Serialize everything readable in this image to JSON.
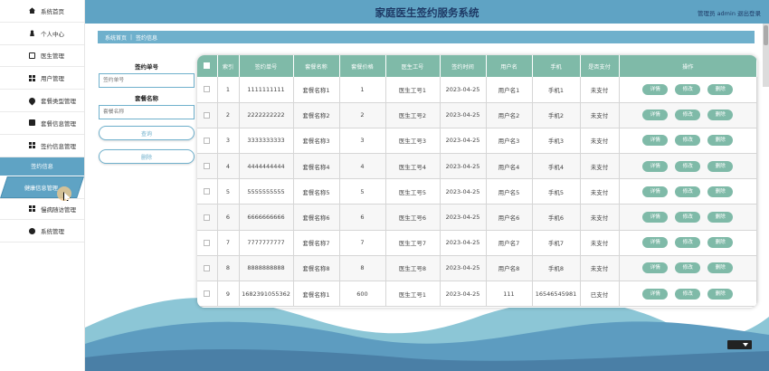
{
  "app": {
    "title": "家庭医生签约服务系统",
    "admin_text": "管理员 admin  退出登录"
  },
  "sidebar": {
    "items_top": [
      {
        "label": "系统首页",
        "icon": "home-icon"
      },
      {
        "label": "个人中心",
        "icon": "user-icon"
      },
      {
        "label": "医生管理",
        "icon": "document-icon"
      },
      {
        "label": "用户管理",
        "icon": "grid-icon"
      },
      {
        "label": "套餐类型管理",
        "icon": "pin-icon"
      },
      {
        "label": "套餐信息管理",
        "icon": "monitor-icon"
      },
      {
        "label": "签约信息管理",
        "icon": "grid-icon"
      }
    ],
    "section_label": "签约信息",
    "active_item": {
      "label": "健康信息管理",
      "icon": "user-icon"
    },
    "items_bottom": [
      {
        "label": "慢病随访管理",
        "icon": "grid-icon"
      },
      {
        "label": "系统管理",
        "icon": "gear-icon"
      }
    ]
  },
  "breadcrumb": {
    "home": "系统首页",
    "separator": "|",
    "current": "签约信息"
  },
  "search": {
    "sign_no_label": "签约单号",
    "sign_no_placeholder": "签约单号",
    "package_label": "套餐名称",
    "package_placeholder": "套餐名称",
    "query_button": "查询",
    "delete_button": "删除"
  },
  "table": {
    "columns": [
      "索引",
      "签约单号",
      "套餐名称",
      "套餐价格",
      "医生工号",
      "签约时间",
      "用户名",
      "手机",
      "是否支付",
      "操作"
    ],
    "action_labels": {
      "detail": "详情",
      "edit": "修改",
      "delete": "删除"
    },
    "rows": [
      [
        "1",
        "1111111111",
        "套餐名称1",
        "1",
        "医生工号1",
        "2023-04-25",
        "用户名1",
        "手机1",
        "未支付"
      ],
      [
        "2",
        "2222222222",
        "套餐名称2",
        "2",
        "医生工号2",
        "2023-04-25",
        "用户名2",
        "手机2",
        "未支付"
      ],
      [
        "3",
        "3333333333",
        "套餐名称3",
        "3",
        "医生工号3",
        "2023-04-25",
        "用户名3",
        "手机3",
        "未支付"
      ],
      [
        "4",
        "4444444444",
        "套餐名称4",
        "4",
        "医生工号4",
        "2023-04-25",
        "用户名4",
        "手机4",
        "未支付"
      ],
      [
        "5",
        "5555555555",
        "套餐名称5",
        "5",
        "医生工号5",
        "2023-04-25",
        "用户名5",
        "手机5",
        "未支付"
      ],
      [
        "6",
        "6666666666",
        "套餐名称6",
        "6",
        "医生工号6",
        "2023-04-25",
        "用户名6",
        "手机6",
        "未支付"
      ],
      [
        "7",
        "7777777777",
        "套餐名称7",
        "7",
        "医生工号7",
        "2023-04-25",
        "用户名7",
        "手机7",
        "未支付"
      ],
      [
        "8",
        "8888888888",
        "套餐名称8",
        "8",
        "医生工号8",
        "2023-04-25",
        "用户名8",
        "手机8",
        "未支付"
      ],
      [
        "9",
        "1682391055362",
        "套餐名称1",
        "600",
        "医生工号1",
        "2023-04-25",
        "111",
        "16546545981",
        "已支付"
      ]
    ]
  },
  "colors": {
    "primary": "#5fa3c4",
    "table_header": "#7fbaa8",
    "title": "#1e3a66"
  }
}
